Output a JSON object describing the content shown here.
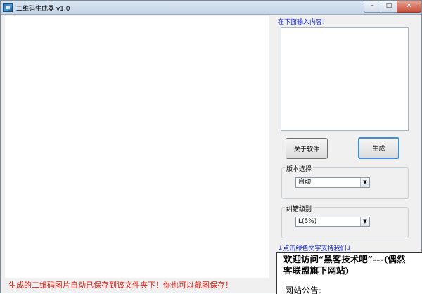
{
  "window": {
    "title": "二维码生成器 v1.0",
    "controls": {
      "minimize": "–",
      "maximize": "□",
      "close": "×"
    }
  },
  "status_message": "生成的二维码图片自动已保存到该文件夹下！你也可以截图保存！",
  "input": {
    "label": "在下面输入内容：",
    "value": ""
  },
  "buttons": {
    "about": "关于软件",
    "generate": "生成"
  },
  "version_group": {
    "title": "版本选择",
    "selected": "自动"
  },
  "ecc_group": {
    "title": "纠错级别",
    "selected": "L(5%)"
  },
  "support_link": "↓点击绿色文字支持我们↓",
  "notice": {
    "welcome_line1": "欢迎访问“黑客技术吧”---(偶然",
    "welcome_line2": "客联盟旗下网站)",
    "board_label": "网站公告:"
  },
  "colors": {
    "status_red": "#e2231a",
    "link_blue": "#1427d8",
    "generate_focus": "#3b8fd6"
  },
  "icons": {
    "app": "qr-app-icon",
    "dropdown": "chevron-down-icon"
  }
}
